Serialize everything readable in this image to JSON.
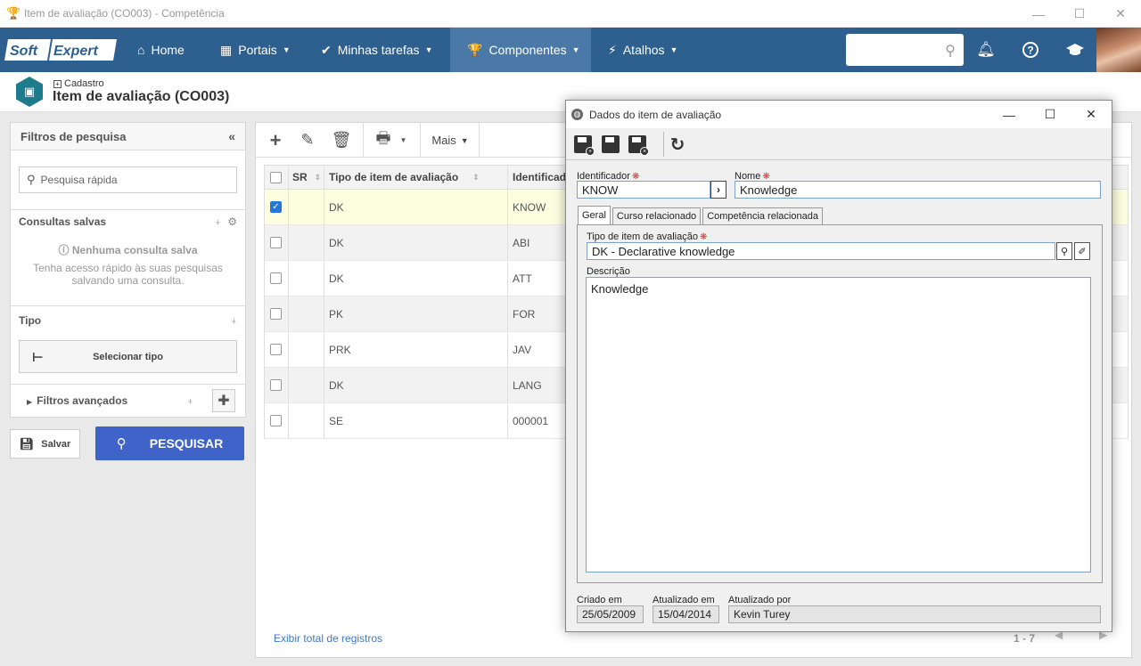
{
  "window": {
    "title": "Item de avaliação (CO003) - Competência",
    "minimize": "—",
    "maximize": "☐",
    "close": "✕"
  },
  "nav": {
    "logo": "SoftExpert",
    "items": [
      {
        "label": "Home",
        "icon": "home-icon"
      },
      {
        "label": "Portais",
        "icon": "grid-icon"
      },
      {
        "label": "Minhas tarefas",
        "icon": "check-icon"
      },
      {
        "label": "Componentes",
        "icon": "trophy-icon"
      },
      {
        "label": "Atalhos",
        "icon": "bolt-icon"
      }
    ],
    "active_color": "#4a79a8",
    "bar_color": "#2d5f8f"
  },
  "header": {
    "breadcrumb": "Cadastro",
    "title": "Item de avaliação (CO003)"
  },
  "filters": {
    "title": "Filtros de pesquisa",
    "quick_search_placeholder": "Pesquisa rápida",
    "saved_title": "Consultas salvas",
    "saved_empty_title": "Nenhuma consulta salva",
    "saved_empty_line1": "Tenha acesso rápido às suas pesquisas",
    "saved_empty_line2": "salvando uma consulta.",
    "type_title": "Tipo",
    "select_type": "Selecionar tipo",
    "advanced": "Filtros avançados",
    "save_button": "Salvar",
    "search_button": "PESQUISAR",
    "search_color": "#3f63c9"
  },
  "grid": {
    "toolbar_more": "Mais",
    "columns": [
      "SR",
      "Tipo de item de avaliação",
      "Identificad"
    ],
    "rows": [
      {
        "sr": "",
        "tipo": "DK",
        "id": "KNOW",
        "checked": true
      },
      {
        "sr": "",
        "tipo": "DK",
        "id": "ABI",
        "checked": false
      },
      {
        "sr": "",
        "tipo": "DK",
        "id": "ATT",
        "checked": false
      },
      {
        "sr": "",
        "tipo": "PK",
        "id": "FOR",
        "checked": false
      },
      {
        "sr": "",
        "tipo": "PRK",
        "id": "JAV",
        "checked": false
      },
      {
        "sr": "",
        "tipo": "DK",
        "id": "LANG",
        "checked": false
      },
      {
        "sr": "",
        "tipo": "SE",
        "id": "000001",
        "checked": false
      }
    ],
    "footer_link": "Exibir total de registros",
    "pager": "1 - 7"
  },
  "dialog": {
    "title": "Dados do item de avaliação",
    "identificador_label": "Identificador",
    "identificador_value": "KNOW",
    "nome_label": "Nome",
    "nome_value": "Knowledge",
    "tabs": [
      "Geral",
      "Curso relacionado",
      "Competência relacionada"
    ],
    "tipo_label": "Tipo de item de avaliação",
    "tipo_value": "DK - Declarative knowledge",
    "descricao_label": "Descrição",
    "descricao_value": "Knowledge",
    "criado_label": "Criado em",
    "criado_value": "25/05/2009",
    "atualizado_label": "Atualizado em",
    "atualizado_value": "15/04/2014",
    "atualizado_por_label": "Atualizado por",
    "atualizado_por_value": "Kevin Turey"
  }
}
